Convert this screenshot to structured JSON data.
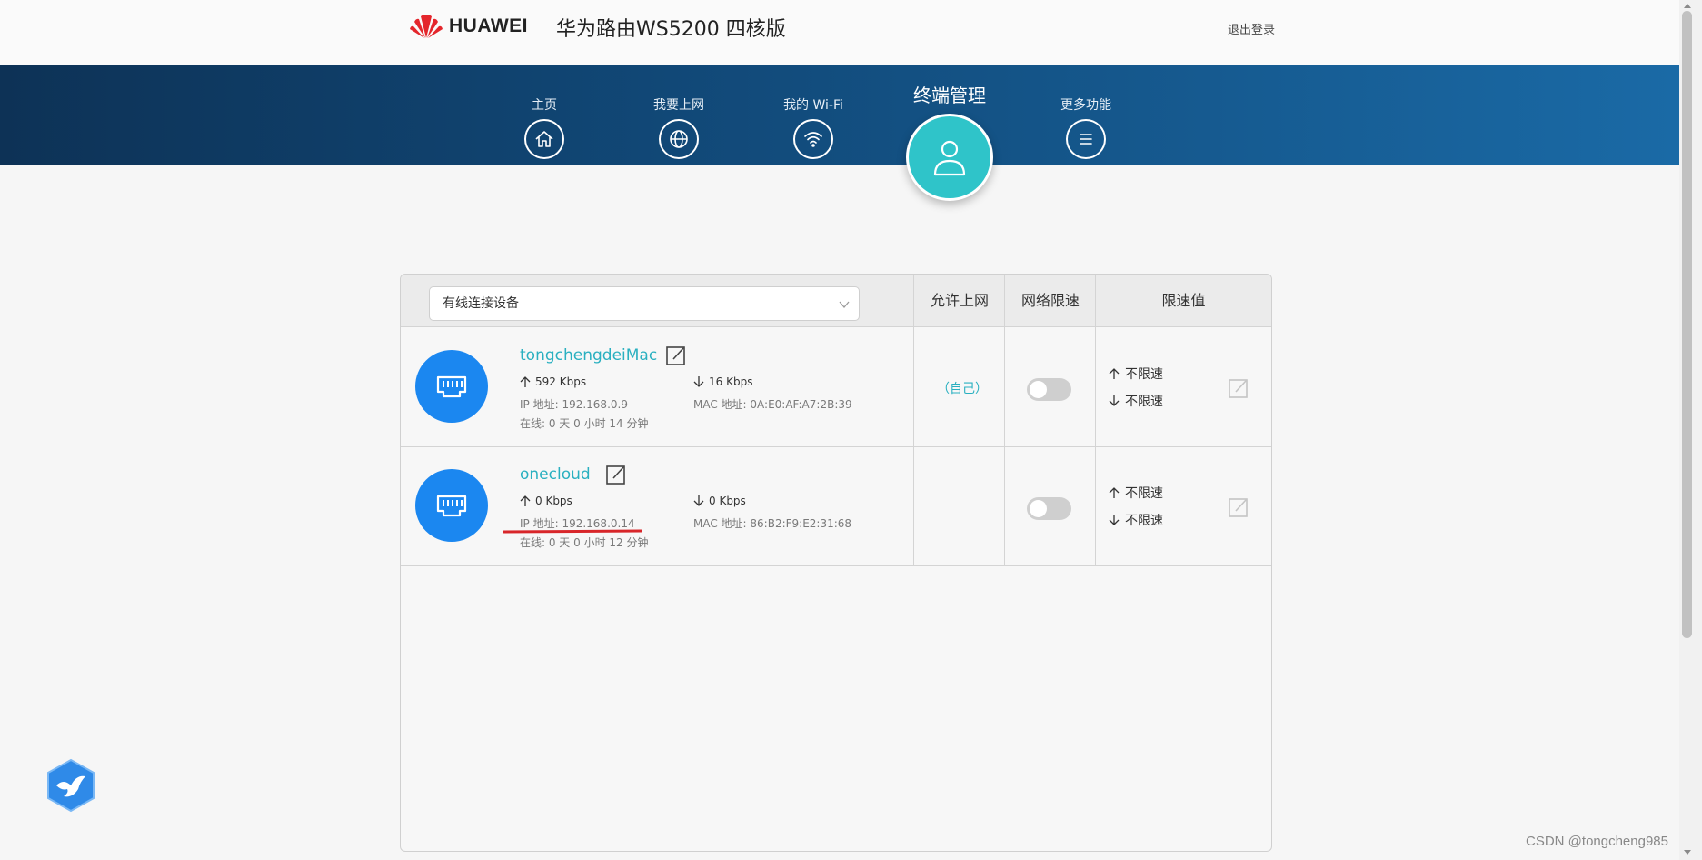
{
  "header": {
    "brand": "HUAWEI",
    "product": "华为路由WS5200 四核版",
    "logout": "退出登录"
  },
  "nav": {
    "items": [
      {
        "label": "主页",
        "icon": "home-icon"
      },
      {
        "label": "我要上网",
        "icon": "globe-icon"
      },
      {
        "label": "我的 Wi-Fi",
        "icon": "wifi-icon"
      },
      {
        "label": "终端管理",
        "icon": "user-icon",
        "active": true
      },
      {
        "label": "更多功能",
        "icon": "menu-icon"
      }
    ]
  },
  "table": {
    "filter_selected": "有线连接设备",
    "col_allow": "允许上网",
    "col_limit": "网络限速",
    "col_limit_value": "限速值"
  },
  "devices": [
    {
      "name": "tongchengdeiMac",
      "up": "592 Kbps",
      "down": "16 Kbps",
      "ip": "IP 地址: 192.168.0.9",
      "mac": "MAC 地址: 0A:E0:AF:A7:2B:39",
      "online": "在线: 0 天 0 小时 14 分钟",
      "allow": "（自己）",
      "limit_enabled": false,
      "up_limit": "不限速",
      "down_limit": "不限速",
      "connection_icon": "ethernet-port-icon"
    },
    {
      "name": "onecloud",
      "up": "0 Kbps",
      "down": "0 Kbps",
      "ip": "IP 地址: 192.168.0.14",
      "mac": "MAC 地址: 86:B2:F9:E2:31:68",
      "online": "在线: 0 天 0 小时 12 分钟",
      "allow": "",
      "limit_enabled": false,
      "up_limit": "不限速",
      "down_limit": "不限速",
      "connection_icon": "ethernet-port-icon"
    }
  ],
  "watermark": "CSDN @tongcheng985",
  "colors": {
    "accent": "#2ab0c0",
    "active_nav": "#2fc4c9",
    "device_icon": "#1b87f0",
    "nav_band": "#114877",
    "annotation": "#d8262a"
  }
}
